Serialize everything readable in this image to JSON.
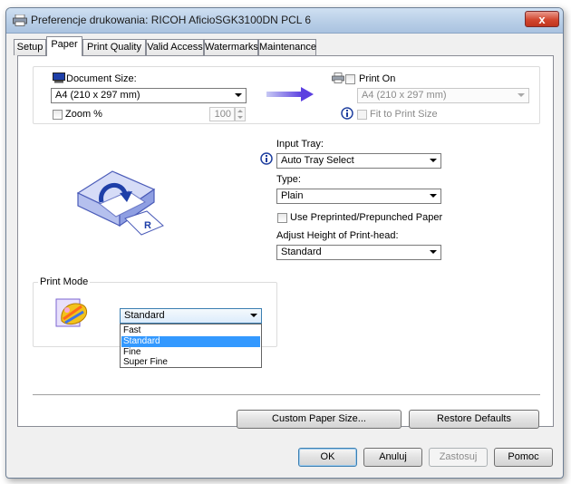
{
  "window": {
    "title": "Preferencje drukowania: RICOH AficioSGK3100DN PCL 6",
    "close_label": "x"
  },
  "tabs": [
    {
      "label": "Setup"
    },
    {
      "label": "Paper"
    },
    {
      "label": "Print Quality"
    },
    {
      "label": "Valid Access"
    },
    {
      "label": "Watermarks"
    },
    {
      "label": "Maintenance"
    }
  ],
  "active_tab": "Paper",
  "document_size": {
    "label": "Document Size:",
    "value": "A4 (210 x 297 mm)"
  },
  "zoom": {
    "label": "Zoom %",
    "value": "100",
    "checked": false
  },
  "print_on": {
    "label": "Print On",
    "value": "A4 (210 x 297 mm)",
    "enabled": false
  },
  "fit_to_print_size": {
    "label": "Fit to Print Size",
    "enabled": false
  },
  "input_tray": {
    "label": "Input Tray:",
    "value": "Auto Tray Select"
  },
  "type": {
    "label": "Type:",
    "value": "Plain"
  },
  "preprinted": {
    "label": "Use Preprinted/Prepunched Paper",
    "checked": false
  },
  "print_head": {
    "label": "Adjust Height of Print-head:",
    "value": "Standard"
  },
  "print_mode": {
    "label": "Print Mode",
    "value": "Standard",
    "options": [
      "Fast",
      "Standard",
      "Fine",
      "Super Fine"
    ],
    "highlighted": "Standard"
  },
  "buttons": {
    "custom_paper_size": "Custom Paper Size...",
    "restore_defaults": "Restore Defaults",
    "ok": "OK",
    "cancel": "Anuluj",
    "apply": "Zastosuj",
    "help": "Pomoc"
  },
  "colors": {
    "accent_blue": "#3399ff",
    "arrow_purple": "#6a52e0"
  },
  "icons": [
    "printer-icon",
    "monitor-icon",
    "printer-small-icon",
    "arrow-right-icon",
    "info-icon",
    "paper-tray-illustration",
    "print-mode-icon",
    "dropdown-arrow-icon"
  ]
}
